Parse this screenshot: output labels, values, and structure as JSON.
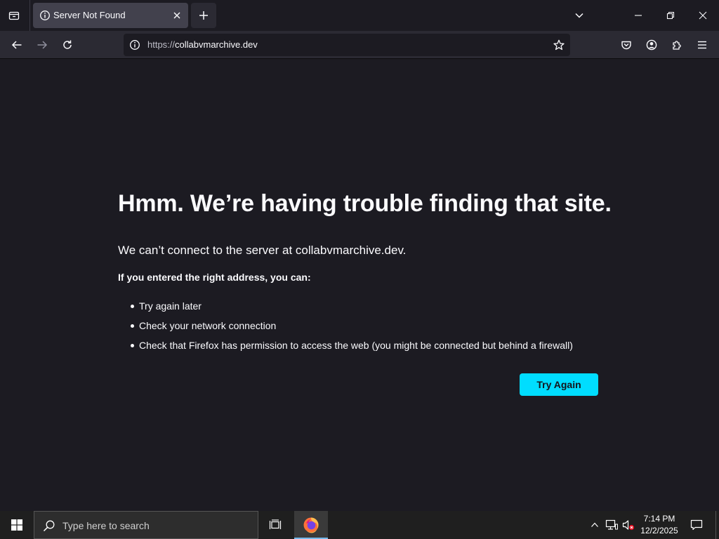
{
  "tab": {
    "title": "Server Not Found"
  },
  "urlbar": {
    "scheme": "https://",
    "host": "collabvmarchive.dev"
  },
  "error": {
    "title": "Hmm. We’re having trouble finding that site.",
    "description": "We can’t connect to the server at collabvmarchive.dev.",
    "subheading": "If you entered the right address, you can:",
    "suggestions": [
      "Try again later",
      "Check your network connection",
      "Check that Firefox has permission to access the web (you might be connected but behind a firewall)"
    ],
    "try_again_label": "Try Again"
  },
  "taskbar": {
    "search_placeholder": "Type here to search",
    "clock_time": "7:14 PM",
    "clock_date": "12/2/2025"
  },
  "colors": {
    "page_bg": "#1c1b22",
    "toolbar_bg": "#2b2a33",
    "tab_active_bg": "#42414d",
    "accent": "#00ddff",
    "text": "#fbfbfe",
    "taskbar_bg": "#1f1f1f"
  },
  "icons": {
    "tab_list": "tab-list-icon",
    "tab_info": "info-icon",
    "tab_close": "close-icon",
    "new_tab": "plus-icon",
    "tab_overflow": "chevron-down-icon",
    "minimize": "minimize-icon",
    "restore": "restore-icon",
    "close_window": "close-window-icon",
    "back": "back-arrow-icon",
    "forward": "forward-arrow-icon",
    "reload": "reload-icon",
    "site_info": "info-icon",
    "bookmark": "star-icon",
    "pocket": "pocket-icon",
    "account": "account-icon",
    "extensions": "puzzle-icon",
    "menu": "hamburger-menu-icon",
    "start": "windows-logo-icon",
    "search": "search-icon",
    "task_view": "task-view-icon",
    "firefox": "firefox-icon",
    "tray_overflow": "chevron-up-icon",
    "network": "network-icon",
    "volume": "volume-muted-icon",
    "notifications": "notification-icon"
  }
}
